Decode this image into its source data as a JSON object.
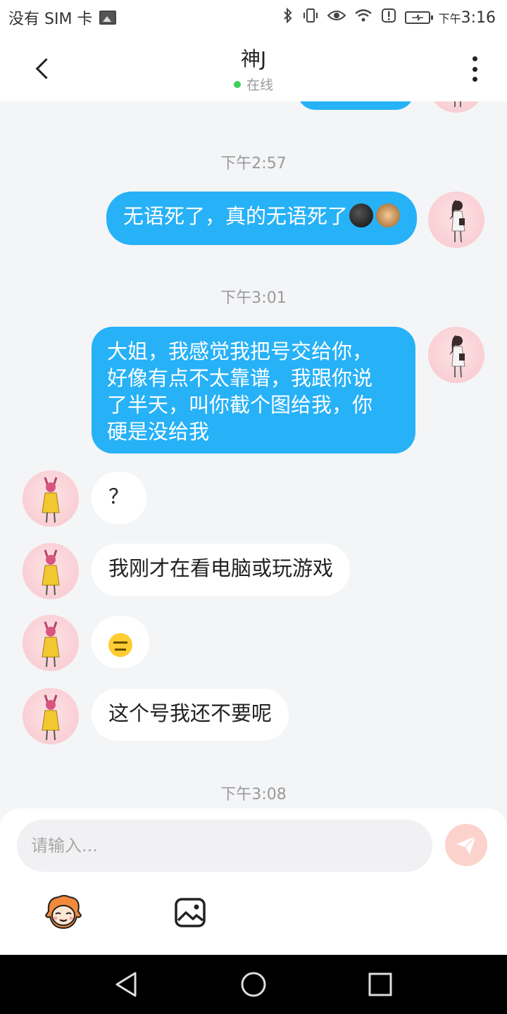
{
  "status_bar": {
    "carrier": "没有 SIM 卡",
    "time_prefix": "下午",
    "time": "3:16"
  },
  "header": {
    "title": "神J",
    "status": "在线",
    "status_color": "#3ecf5a"
  },
  "messages": {
    "ts1": "下午2:57",
    "m1": {
      "text": "无语死了，真的无语死了",
      "side": "out"
    },
    "ts2": "下午3:01",
    "m2": {
      "line1": "大姐，我感觉我把号交给你，",
      "line2": "好像有点不太靠谱，我跟你说",
      "line3": "了半天，叫你截个图给我，你",
      "line4": "硬是没给我",
      "side": "out"
    },
    "m3": {
      "text": "？",
      "side": "in"
    },
    "m4": {
      "text": "我刚才在看电脑或玩游戏",
      "side": "in"
    },
    "m5": {
      "emoji": "expressionless-face",
      "side": "in"
    },
    "m6": {
      "text": "这个号我还不要呢",
      "side": "in"
    },
    "ts3": "下午3:08"
  },
  "composer": {
    "placeholder": "请输入...",
    "send_icon": "send-icon",
    "tools": [
      "sticker-icon",
      "image-icon"
    ]
  },
  "colors": {
    "outgoing_bubble": "#27b1f7",
    "incoming_bubble": "#ffffff",
    "background": "#f4f5f7"
  }
}
